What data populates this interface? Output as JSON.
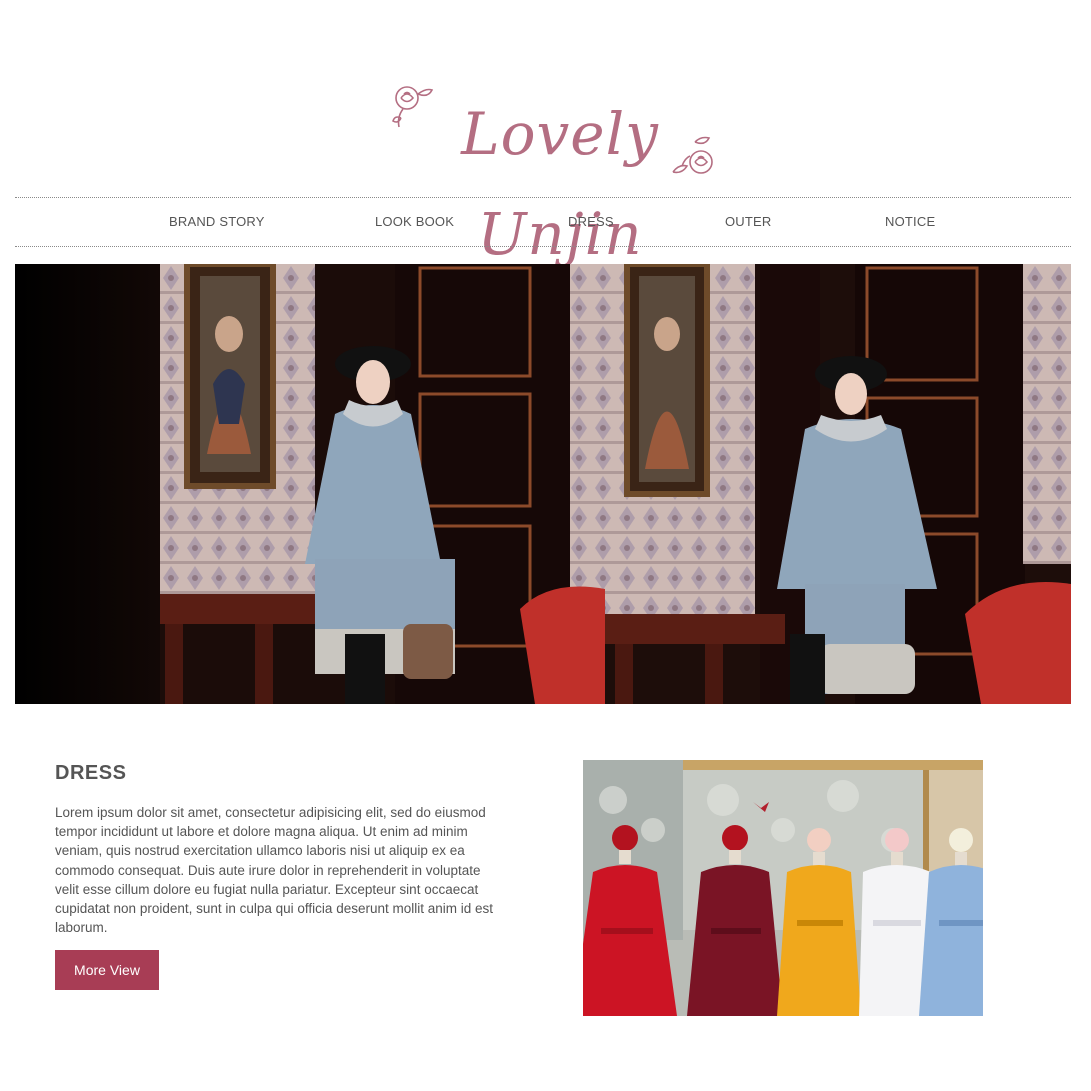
{
  "brand": {
    "logo_text": "Lovely Unjin",
    "accent_color": "#b46e82"
  },
  "nav": {
    "items": [
      {
        "label": "BRAND STORY"
      },
      {
        "label": "LOOK BOOK"
      },
      {
        "label": "DRESS"
      },
      {
        "label": "OUTER"
      },
      {
        "label": "NOTICE"
      }
    ]
  },
  "hero": {
    "image": "photo of a woman in a light blue fur-collar cape coat and black hat in an ornate room, shown twice side by side"
  },
  "dress_section": {
    "title": "DRESS",
    "body": "Lorem ipsum dolor sit amet, consectetur adipisicing elit, sed do eiusmod tempor incididunt ut labore et dolore magna aliqua. Ut enim ad minim veniam, quis nostrud exercitation ullamco laboris nisi ut aliquip ex ea commodo consequat. Duis aute irure dolor in reprehenderit in voluptate velit esse cillum dolore eu fugiat nulla pariatur. Excepteur sint occaecat cupidatat non proident, sunt in culpa qui officia deserunt mollit anim id est laborum.",
    "button_label": "More View",
    "button_color": "#a83d55",
    "image": "five dresses on mannequins with flower crowns: red, burgundy, mustard, white, light blue"
  }
}
